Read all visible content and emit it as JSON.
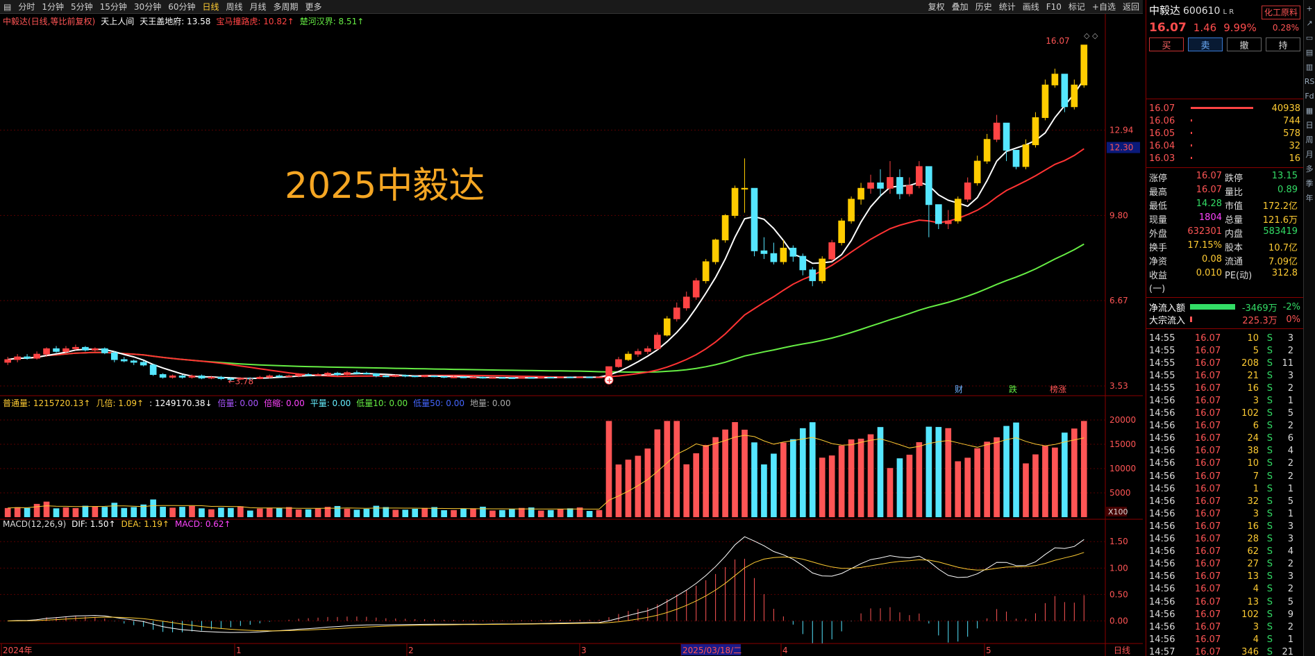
{
  "toolbar": {
    "left_tabs": [
      "分时",
      "1分钟",
      "5分钟",
      "15分钟",
      "30分钟",
      "60分钟",
      "日线",
      "周线",
      "月线",
      "多周期",
      "更多"
    ],
    "active_tab": "日线",
    "right_items": [
      "复权",
      "叠加",
      "历史",
      "统计",
      "画线",
      "F10",
      "标记",
      "+自选",
      "返回"
    ]
  },
  "main_chart": {
    "title": "中毅达(日线,等比前复权)",
    "indicators": [
      {
        "label": "天上人间",
        "color": "#ffffff"
      },
      {
        "label": "天王盖地府: 13.58",
        "color": "#ffffff"
      },
      {
        "label": "宝马撞路虎: 10.82↑",
        "color": "#ff4444"
      },
      {
        "label": "楚河汉界: 8.51↑",
        "color": "#66ee44"
      }
    ],
    "watermark": "2025中毅达",
    "high_label": "16.07",
    "low_label": "3.78",
    "price_axis": [
      "12.94",
      "9.80",
      "6.67",
      "3.53"
    ],
    "current_price_tag": "12.30",
    "markers": [
      {
        "text": "财",
        "color": "#6fb1ff"
      },
      {
        "text": "跌",
        "color": "#66ee44"
      },
      {
        "text": "榜涨",
        "color": "#ff5555"
      }
    ]
  },
  "volume_chart": {
    "legend": [
      {
        "label": "普通量: 1215720.13↑",
        "color": "#ffcc33"
      },
      {
        "label": "几倍: 1.09↑",
        "color": "#ffcc33"
      },
      {
        "label": ": 1249170.38↓",
        "color": "#ffffff"
      },
      {
        "label": "倍量: 0.00",
        "color": "#aa55ff"
      },
      {
        "label": "倍缩: 0.00",
        "color": "#ff44ff"
      },
      {
        "label": "平量: 0.00",
        "color": "#66eeff"
      },
      {
        "label": "低量10: 0.00",
        "color": "#66ee44"
      },
      {
        "label": "低量50: 0.00",
        "color": "#4466ff"
      },
      {
        "label": "地量: 0.00",
        "color": "#aaaaaa"
      }
    ],
    "axis": [
      "20000",
      "15000",
      "10000",
      "5000"
    ],
    "unit": "X100"
  },
  "macd_chart": {
    "legend": [
      {
        "label": "MACD(12,26,9)",
        "color": "#dddddd"
      },
      {
        "label": "DIF: 1.50↑",
        "color": "#ffffff"
      },
      {
        "label": "DEA: 1.19↑",
        "color": "#ffcc33"
      },
      {
        "label": "MACD: 0.62↑",
        "color": "#ff44ff"
      }
    ],
    "axis": [
      "1.50",
      "1.00",
      "0.50",
      "0.00"
    ]
  },
  "date_axis": {
    "labels": [
      "2024年",
      "1",
      "2",
      "3",
      "2025/03/18/二",
      "4",
      "5"
    ],
    "period": "日线"
  },
  "chart_data": {
    "type": "candlestick",
    "ylim": [
      3.53,
      16.5
    ],
    "series": [
      {
        "name": "天王盖地府",
        "color": "#ffffff"
      },
      {
        "name": "宝马撞路虎",
        "color": "#ff3333"
      },
      {
        "name": "楚河汉界",
        "color": "#66ee44"
      }
    ],
    "candles": [
      [
        4.4,
        4.5,
        4.6,
        4.3
      ],
      [
        4.5,
        4.6,
        4.7,
        4.4
      ],
      [
        4.6,
        4.55,
        4.7,
        4.5
      ],
      [
        4.55,
        4.7,
        4.8,
        4.5
      ],
      [
        4.7,
        4.9,
        4.95,
        4.6
      ],
      [
        4.9,
        4.8,
        5.0,
        4.75
      ],
      [
        4.8,
        4.9,
        5.0,
        4.7
      ],
      [
        4.9,
        4.95,
        5.05,
        4.85
      ],
      [
        4.95,
        4.85,
        5.0,
        4.8
      ],
      [
        4.85,
        4.9,
        4.95,
        4.8
      ],
      [
        4.9,
        4.75,
        4.95,
        4.7
      ],
      [
        4.75,
        4.5,
        4.8,
        4.4
      ],
      [
        4.5,
        4.45,
        4.6,
        4.4
      ],
      [
        4.45,
        4.4,
        4.5,
        4.3
      ],
      [
        4.4,
        4.3,
        4.45,
        4.25
      ],
      [
        4.3,
        3.95,
        4.35,
        3.9
      ],
      [
        3.95,
        3.85,
        4.0,
        3.8
      ],
      [
        3.85,
        3.9,
        3.95,
        3.8
      ],
      [
        3.9,
        3.85,
        3.95,
        3.8
      ],
      [
        3.85,
        3.9,
        3.95,
        3.8
      ],
      [
        3.9,
        3.82,
        3.95,
        3.78
      ],
      [
        3.82,
        3.85,
        3.9,
        3.78
      ],
      [
        3.85,
        3.8,
        3.9,
        3.75
      ],
      [
        3.8,
        3.78,
        3.85,
        3.7
      ],
      [
        3.78,
        3.82,
        3.85,
        3.75
      ],
      [
        3.82,
        3.8,
        3.85,
        3.75
      ],
      [
        3.8,
        3.85,
        3.9,
        3.78
      ],
      [
        3.85,
        3.9,
        3.95,
        3.8
      ],
      [
        3.9,
        3.88,
        3.95,
        3.85
      ],
      [
        3.88,
        3.9,
        3.95,
        3.85
      ],
      [
        3.9,
        3.95,
        4.0,
        3.85
      ],
      [
        3.95,
        3.92,
        4.0,
        3.9
      ],
      [
        3.92,
        3.95,
        4.0,
        3.9
      ],
      [
        3.95,
        4.0,
        4.05,
        3.9
      ],
      [
        4.0,
        3.95,
        4.05,
        3.9
      ],
      [
        3.95,
        4.02,
        4.08,
        3.92
      ],
      [
        4.02,
        4.0,
        4.1,
        3.95
      ],
      [
        4.0,
        3.98,
        4.05,
        3.95
      ],
      [
        3.98,
        3.9,
        4.0,
        3.85
      ],
      [
        3.9,
        3.88,
        3.95,
        3.85
      ],
      [
        3.88,
        3.92,
        3.95,
        3.85
      ],
      [
        3.92,
        3.9,
        3.95,
        3.85
      ],
      [
        3.9,
        3.88,
        3.92,
        3.85
      ],
      [
        3.88,
        3.9,
        3.92,
        3.85
      ],
      [
        3.9,
        3.88,
        3.92,
        3.85
      ],
      [
        3.88,
        3.85,
        3.9,
        3.82
      ],
      [
        3.85,
        3.86,
        3.9,
        3.82
      ],
      [
        3.86,
        3.84,
        3.88,
        3.82
      ],
      [
        3.84,
        3.85,
        3.88,
        3.82
      ],
      [
        3.85,
        3.82,
        3.88,
        3.8
      ],
      [
        3.82,
        3.84,
        3.86,
        3.8
      ],
      [
        3.84,
        3.83,
        3.86,
        3.8
      ],
      [
        3.83,
        3.82,
        3.85,
        3.8
      ],
      [
        3.82,
        3.84,
        3.86,
        3.8
      ],
      [
        3.84,
        3.83,
        3.86,
        3.8
      ],
      [
        3.83,
        3.85,
        3.87,
        3.8
      ],
      [
        3.85,
        3.84,
        3.87,
        3.82
      ],
      [
        3.84,
        3.86,
        3.88,
        3.82
      ],
      [
        3.86,
        3.85,
        3.88,
        3.83
      ],
      [
        3.85,
        3.86,
        3.88,
        3.83
      ],
      [
        3.86,
        3.85,
        3.88,
        3.84
      ],
      [
        3.85,
        3.86,
        3.88,
        3.84
      ],
      [
        3.86,
        4.24,
        4.24,
        3.85
      ],
      [
        4.24,
        4.5,
        4.6,
        4.2
      ],
      [
        4.5,
        4.7,
        4.8,
        4.45
      ],
      [
        4.7,
        4.8,
        4.9,
        4.6
      ],
      [
        4.8,
        4.9,
        5.0,
        4.7
      ],
      [
        4.9,
        5.4,
        5.5,
        4.85
      ],
      [
        5.4,
        6.0,
        6.1,
        5.35
      ],
      [
        6.0,
        6.4,
        6.6,
        5.9
      ],
      [
        6.4,
        6.8,
        7.0,
        6.3
      ],
      [
        6.8,
        7.4,
        7.5,
        6.7
      ],
      [
        7.4,
        8.1,
        8.2,
        7.3
      ],
      [
        8.1,
        8.9,
        8.95,
        8.0
      ],
      [
        8.9,
        9.8,
        9.85,
        8.8
      ],
      [
        9.8,
        10.8,
        10.9,
        9.7
      ],
      [
        10.8,
        10.8,
        11.9,
        9.9
      ],
      [
        10.8,
        8.5,
        9.5,
        8.3
      ],
      [
        8.5,
        8.4,
        9.0,
        8.2
      ],
      [
        8.4,
        8.1,
        8.8,
        8.0
      ],
      [
        8.1,
        8.6,
        8.9,
        8.0
      ],
      [
        8.6,
        8.3,
        8.7,
        8.1
      ],
      [
        8.3,
        7.8,
        8.4,
        7.6
      ],
      [
        7.8,
        7.4,
        7.9,
        7.2
      ],
      [
        7.4,
        8.2,
        8.3,
        7.3
      ],
      [
        8.2,
        8.8,
        8.9,
        8.1
      ],
      [
        8.8,
        9.6,
        9.7,
        8.7
      ],
      [
        9.6,
        10.4,
        10.5,
        9.5
      ],
      [
        10.4,
        10.8,
        11.0,
        10.2
      ],
      [
        10.8,
        11.0,
        11.3,
        10.6
      ],
      [
        11.0,
        10.8,
        11.5,
        10.5
      ],
      [
        10.8,
        11.2,
        11.8,
        10.6
      ],
      [
        11.2,
        10.6,
        11.5,
        10.4
      ],
      [
        10.6,
        10.9,
        11.2,
        10.5
      ],
      [
        10.9,
        11.6,
        11.8,
        10.8
      ],
      [
        11.6,
        10.2,
        10.5,
        9.0
      ],
      [
        10.2,
        9.5,
        10.0,
        9.3
      ],
      [
        9.5,
        9.6,
        10.0,
        9.3
      ],
      [
        9.6,
        10.4,
        10.5,
        9.5
      ],
      [
        10.4,
        11.0,
        11.2,
        10.3
      ],
      [
        11.0,
        11.8,
        12.0,
        10.9
      ],
      [
        11.8,
        12.6,
        12.8,
        11.7
      ],
      [
        12.6,
        13.2,
        13.5,
        12.5
      ],
      [
        13.2,
        12.2,
        12.4,
        11.8
      ],
      [
        12.2,
        11.6,
        12.0,
        11.5
      ],
      [
        11.6,
        12.4,
        12.6,
        11.5
      ],
      [
        12.4,
        13.4,
        13.6,
        12.3
      ],
      [
        13.4,
        14.6,
        14.8,
        13.3
      ],
      [
        14.6,
        15.0,
        15.2,
        14.5
      ],
      [
        15.0,
        13.8,
        14.2,
        13.6
      ],
      [
        13.8,
        14.6,
        14.8,
        13.7
      ],
      [
        14.6,
        16.07,
        16.07,
        14.5
      ]
    ],
    "dif_axis_ylim": [
      -0.4,
      1.7
    ],
    "volume_ylim": [
      0,
      21000
    ]
  },
  "right_panel": {
    "name": "中毅达",
    "code": "600610",
    "tag": "L R",
    "industry": "化工原料",
    "industry_pct": "0.28%",
    "price": "16.07",
    "change": "1.46",
    "change_pct": "9.99%",
    "buttons": [
      "买",
      "卖",
      "撤",
      "持"
    ],
    "orderbook": [
      {
        "price": "16.07",
        "vol": "40938",
        "bar": 0.92
      },
      {
        "price": "16.06",
        "vol": "744",
        "bar": 0.02
      },
      {
        "price": "16.05",
        "vol": "578",
        "bar": 0.015
      },
      {
        "price": "16.04",
        "vol": "32",
        "bar": 0.005
      },
      {
        "price": "16.03",
        "vol": "16",
        "bar": 0.004
      }
    ],
    "stats": [
      {
        "k1": "涨停",
        "v1": "16.07",
        "c1": "#ff5555",
        "k2": "跌停",
        "v2": "13.15",
        "c2": "#33dd66"
      },
      {
        "k1": "最高",
        "v1": "16.07",
        "c1": "#ff5555",
        "k2": "量比",
        "v2": "0.89",
        "c2": "#33dd66"
      },
      {
        "k1": "最低",
        "v1": "14.28",
        "c1": "#33dd66",
        "k2": "市值",
        "v2": "172.2亿",
        "c2": "#ffcc33"
      },
      {
        "k1": "现量",
        "v1": "1804",
        "c1": "#ff44ff",
        "k2": "总量",
        "v2": "121.6万",
        "c2": "#ffcc33"
      },
      {
        "k1": "外盘",
        "v1": "632301",
        "c1": "#ff5555",
        "k2": "内盘",
        "v2": "583419",
        "c2": "#33dd66"
      },
      {
        "k1": "换手",
        "v1": "17.15%",
        "c1": "#ffcc33",
        "k2": "股本",
        "v2": "10.7亿",
        "c2": "#ffcc33"
      },
      {
        "k1": "净资",
        "v1": "0.08",
        "c1": "#ffcc33",
        "k2": "流通",
        "v2": "7.09亿",
        "c2": "#ffcc33"
      },
      {
        "k1": "收益(一)",
        "v1": "0.010",
        "c1": "#ffcc33",
        "k2": "PE(动)",
        "v2": "312.8",
        "c2": "#ffcc33"
      }
    ],
    "flows": [
      {
        "label": "净流入额",
        "value": "-3469万",
        "pct": "-2%",
        "color": "#33dd66",
        "bar": 0.95
      },
      {
        "label": "大宗流入",
        "value": "225.3万",
        "pct": "0%",
        "color": "#ff5555",
        "bar": 0.04
      }
    ],
    "ticks": [
      [
        "14:55",
        "16.07",
        "10",
        "S",
        "3"
      ],
      [
        "14:55",
        "16.07",
        "5",
        "S",
        "2"
      ],
      [
        "14:55",
        "16.07",
        "208",
        "S",
        "11"
      ],
      [
        "14:55",
        "16.07",
        "21",
        "S",
        "3"
      ],
      [
        "14:55",
        "16.07",
        "16",
        "S",
        "2"
      ],
      [
        "14:56",
        "16.07",
        "3",
        "S",
        "1"
      ],
      [
        "14:56",
        "16.07",
        "102",
        "S",
        "5"
      ],
      [
        "14:56",
        "16.07",
        "6",
        "S",
        "2"
      ],
      [
        "14:56",
        "16.07",
        "24",
        "S",
        "6"
      ],
      [
        "14:56",
        "16.07",
        "38",
        "S",
        "4"
      ],
      [
        "14:56",
        "16.07",
        "10",
        "S",
        "2"
      ],
      [
        "14:56",
        "16.07",
        "7",
        "S",
        "2"
      ],
      [
        "14:56",
        "16.07",
        "1",
        "S",
        "1"
      ],
      [
        "14:56",
        "16.07",
        "32",
        "S",
        "5"
      ],
      [
        "14:56",
        "16.07",
        "3",
        "S",
        "1"
      ],
      [
        "14:56",
        "16.07",
        "16",
        "S",
        "3"
      ],
      [
        "14:56",
        "16.07",
        "28",
        "S",
        "3"
      ],
      [
        "14:56",
        "16.07",
        "62",
        "S",
        "4"
      ],
      [
        "14:56",
        "16.07",
        "27",
        "S",
        "2"
      ],
      [
        "14:56",
        "16.07",
        "13",
        "S",
        "3"
      ],
      [
        "14:56",
        "16.07",
        "4",
        "S",
        "2"
      ],
      [
        "14:56",
        "16.07",
        "13",
        "S",
        "5"
      ],
      [
        "14:56",
        "16.07",
        "102",
        "S",
        "9"
      ],
      [
        "14:56",
        "16.07",
        "3",
        "S",
        "2"
      ],
      [
        "14:56",
        "16.07",
        "4",
        "S",
        "1"
      ],
      [
        "14:57",
        "16.07",
        "346",
        "S",
        "21"
      ]
    ]
  },
  "side_strip": [
    "+",
    "↗",
    "▭",
    "▤",
    "▥",
    "RS",
    "Fd",
    "▦",
    "日",
    "周",
    "月",
    "多",
    "季",
    "年"
  ]
}
